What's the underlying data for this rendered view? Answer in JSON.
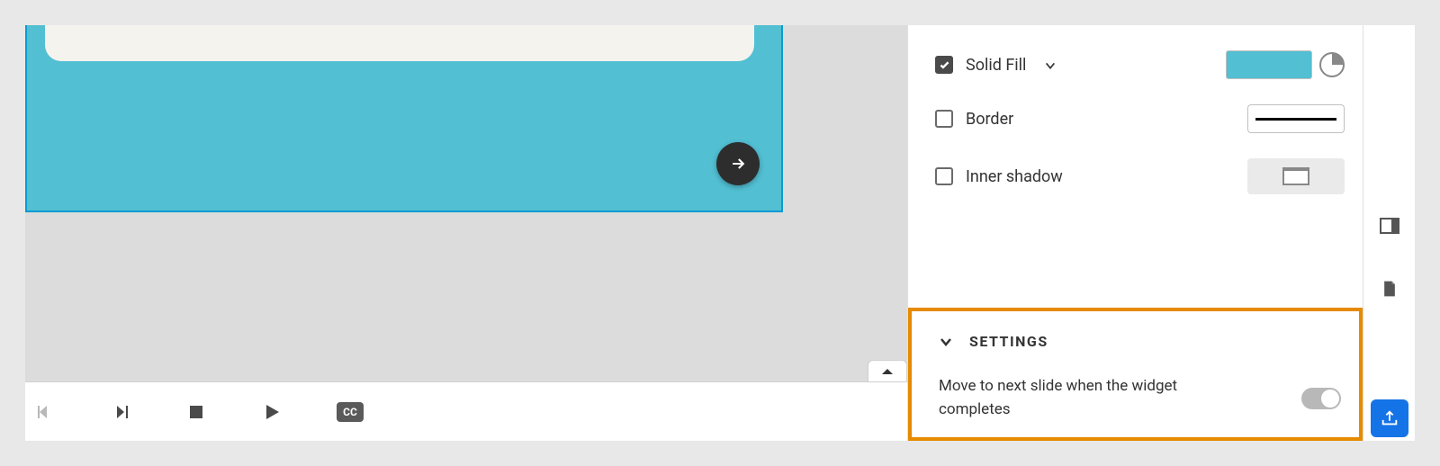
{
  "properties": {
    "solid_fill": {
      "label": "Solid Fill",
      "checked": true,
      "color": "#52bfd3"
    },
    "border": {
      "label": "Border",
      "checked": false
    },
    "inner_shadow": {
      "label": "Inner shadow",
      "checked": false
    }
  },
  "settings": {
    "title": "SETTINGS",
    "move_next_label": "Move to next slide when the widget completes",
    "move_next_enabled": false
  },
  "playback": {
    "cc_label": "CC"
  }
}
